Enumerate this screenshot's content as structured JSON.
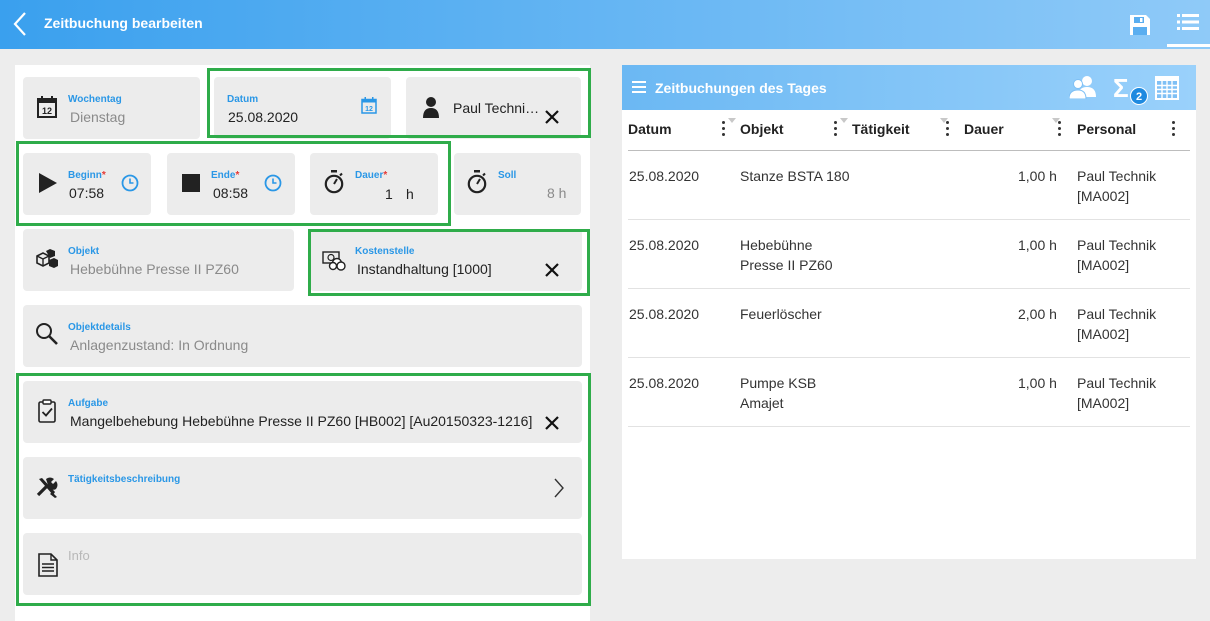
{
  "header": {
    "title": "Zeitbuchung bearbeiten"
  },
  "form": {
    "wochentag": {
      "label": "Wochentag",
      "value": "Dienstag"
    },
    "datum": {
      "label": "Datum",
      "value": "25.08.2020"
    },
    "personal": {
      "value": "Paul Techni…"
    },
    "beginn": {
      "label": "Beginn",
      "required": "*",
      "value": "07:58"
    },
    "ende": {
      "label": "Ende",
      "required": "*",
      "value": "08:58"
    },
    "dauer": {
      "label": "Dauer",
      "required": "*",
      "value": "1",
      "unit": "h"
    },
    "soll": {
      "label": "Soll",
      "value": "8 h"
    },
    "objekt": {
      "label": "Objekt",
      "value": "Hebebühne Presse II PZ60"
    },
    "kostenstelle": {
      "label": "Kostenstelle",
      "value": "Instandhaltung [1000]"
    },
    "objektdetails": {
      "label": "Objektdetails",
      "value": "Anlagenzustand: In Ordnung"
    },
    "aufgabe": {
      "label": "Aufgabe",
      "value": "Mangelbehebung Hebebühne Presse II PZ60 [HB002] [Au20150323-1216]"
    },
    "taetigkeit": {
      "label": "Tätigkeitsbeschreibung"
    },
    "info": {
      "placeholder": "Info"
    }
  },
  "panel": {
    "title": "Zeitbuchungen des Tages",
    "badge": "2",
    "sigma": "Σ",
    "columns": [
      "Datum",
      "Objekt",
      "Tätigkeit",
      "Dauer",
      "Personal"
    ],
    "rows": [
      {
        "datum": "25.08.2020",
        "objekt1": "Stanze BSTA 180",
        "objekt2": "",
        "dauer": "1,00 h",
        "personal1": "Paul Technik",
        "personal2": "[MA002]"
      },
      {
        "datum": "25.08.2020",
        "objekt1": "Hebebühne",
        "objekt2": "Presse II PZ60",
        "dauer": "1,00 h",
        "personal1": "Paul Technik",
        "personal2": "[MA002]"
      },
      {
        "datum": "25.08.2020",
        "objekt1": "Feuerlöscher",
        "objekt2": "",
        "dauer": "2,00 h",
        "personal1": "Paul Technik",
        "personal2": "[MA002]"
      },
      {
        "datum": "25.08.2020",
        "objekt1": "Pumpe KSB",
        "objekt2": "Amajet",
        "dauer": "1,00 h",
        "personal1": "Paul Technik",
        "personal2": "[MA002]"
      }
    ]
  },
  "colors": {
    "accent": "#2a97e6",
    "highlight": "#2fac4a",
    "header": "#3aa0ee"
  },
  "icons": [
    "chevron-left-icon",
    "save-icon",
    "list-icon",
    "calendar-icon",
    "person-icon",
    "close-icon",
    "play-icon",
    "stop-icon",
    "clock-icon",
    "stopwatch-icon",
    "cubes-icon",
    "cost-center-icon",
    "magnifier-icon",
    "clipboard-check-icon",
    "tools-icon",
    "chevron-right-icon",
    "document-icon",
    "hamburger-icon",
    "people-icon",
    "sigma-icon",
    "table-icon"
  ]
}
